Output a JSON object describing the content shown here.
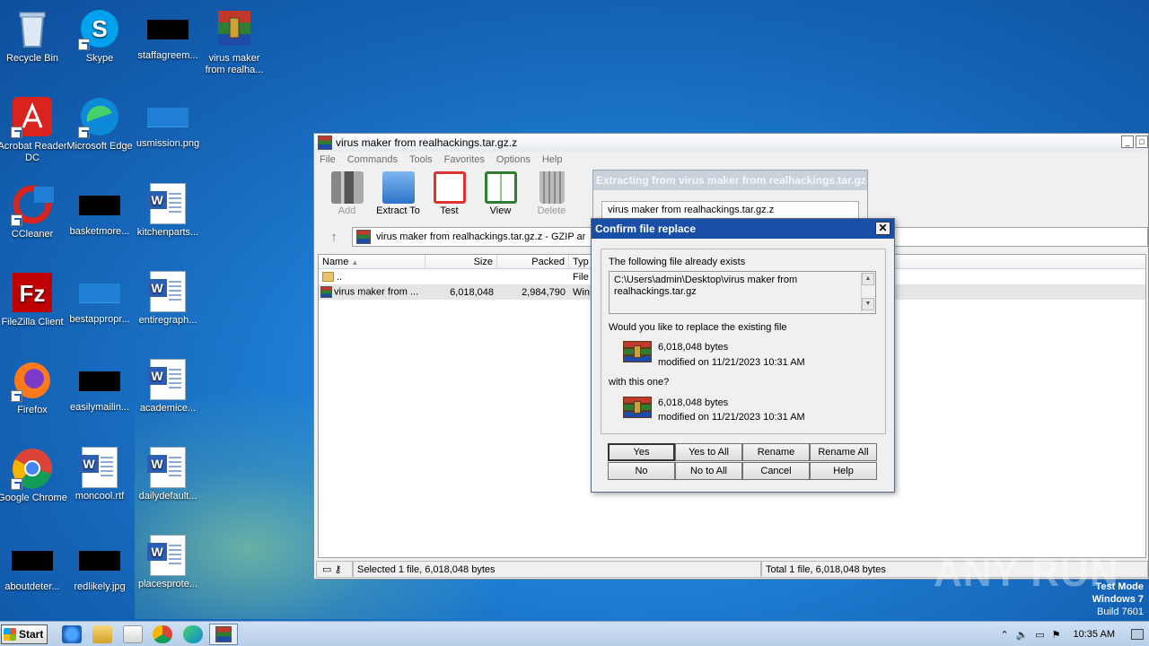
{
  "desktop": {
    "icons": [
      {
        "label": "Recycle Bin"
      },
      {
        "label": "Skype"
      },
      {
        "label": "staffagreem..."
      },
      {
        "label": "virus maker from realha..."
      },
      {
        "label": "Acrobat Reader DC"
      },
      {
        "label": "Microsoft Edge"
      },
      {
        "label": "usmission.png"
      },
      {
        "label": "CCleaner"
      },
      {
        "label": "basketmore..."
      },
      {
        "label": "kitchenparts..."
      },
      {
        "label": "FileZilla Client"
      },
      {
        "label": "bestappropr..."
      },
      {
        "label": "entiregraph..."
      },
      {
        "label": "Firefox"
      },
      {
        "label": "easilymailin..."
      },
      {
        "label": "academice..."
      },
      {
        "label": "Google Chrome"
      },
      {
        "label": "moncool.rtf"
      },
      {
        "label": "dailydefault..."
      },
      {
        "label": "aboutdeter..."
      },
      {
        "label": "redlikely.jpg"
      },
      {
        "label": "placesprote..."
      }
    ]
  },
  "winrar": {
    "title": "virus maker from realhackings.tar.gz.z",
    "menu": [
      "File",
      "Commands",
      "Tools",
      "Favorites",
      "Options",
      "Help"
    ],
    "toolbar": [
      {
        "label": "Add",
        "icon": "add-archive-icon"
      },
      {
        "label": "Extract To",
        "icon": "extract-folder-icon"
      },
      {
        "label": "Test",
        "icon": "test-clipboard-icon"
      },
      {
        "label": "View",
        "icon": "view-book-icon"
      },
      {
        "label": "Delete",
        "icon": "trash-icon"
      }
    ],
    "address": "virus maker from realhackings.tar.gz.z - GZIP ar",
    "columns": [
      "Name",
      "Size",
      "Packed",
      "Typ"
    ],
    "rows": [
      {
        "name": "..",
        "size": "",
        "packed": "",
        "type": "File"
      },
      {
        "name": "virus maker from ...",
        "size": "6,018,048",
        "packed": "2,984,790",
        "type": "Win"
      }
    ],
    "status_left": "Selected 1 file, 6,018,048 bytes",
    "status_right": "Total 1 file, 6,018,048 bytes"
  },
  "extracting": {
    "title": "Extracting from virus maker from realhackings.tar.gz.z",
    "file": "virus maker from realhackings.tar.gz.z"
  },
  "confirm": {
    "title": "Confirm file replace",
    "exists_text": "The following file already exists",
    "path": "C:\\Users\\admin\\Desktop\\virus maker from realhackings.tar.gz",
    "question": "Would you like to replace the existing file",
    "existing_size": "6,018,048 bytes",
    "existing_modified": "modified on 11/21/2023 10:31 AM",
    "with_text": "with this one?",
    "new_size": "6,018,048 bytes",
    "new_modified": "modified on 11/21/2023 10:31 AM",
    "buttons": {
      "yes": "Yes",
      "yes_all": "Yes to All",
      "rename": "Rename",
      "rename_all": "Rename All",
      "no": "No",
      "no_all": "No to All",
      "cancel": "Cancel",
      "help": "Help"
    }
  },
  "taskbar": {
    "start": "Start",
    "time": "10:35 AM"
  },
  "watermark": {
    "line1": "Test Mode",
    "line2": "Windows 7",
    "line3": "Build 7601",
    "brand": "ANY RUN"
  }
}
